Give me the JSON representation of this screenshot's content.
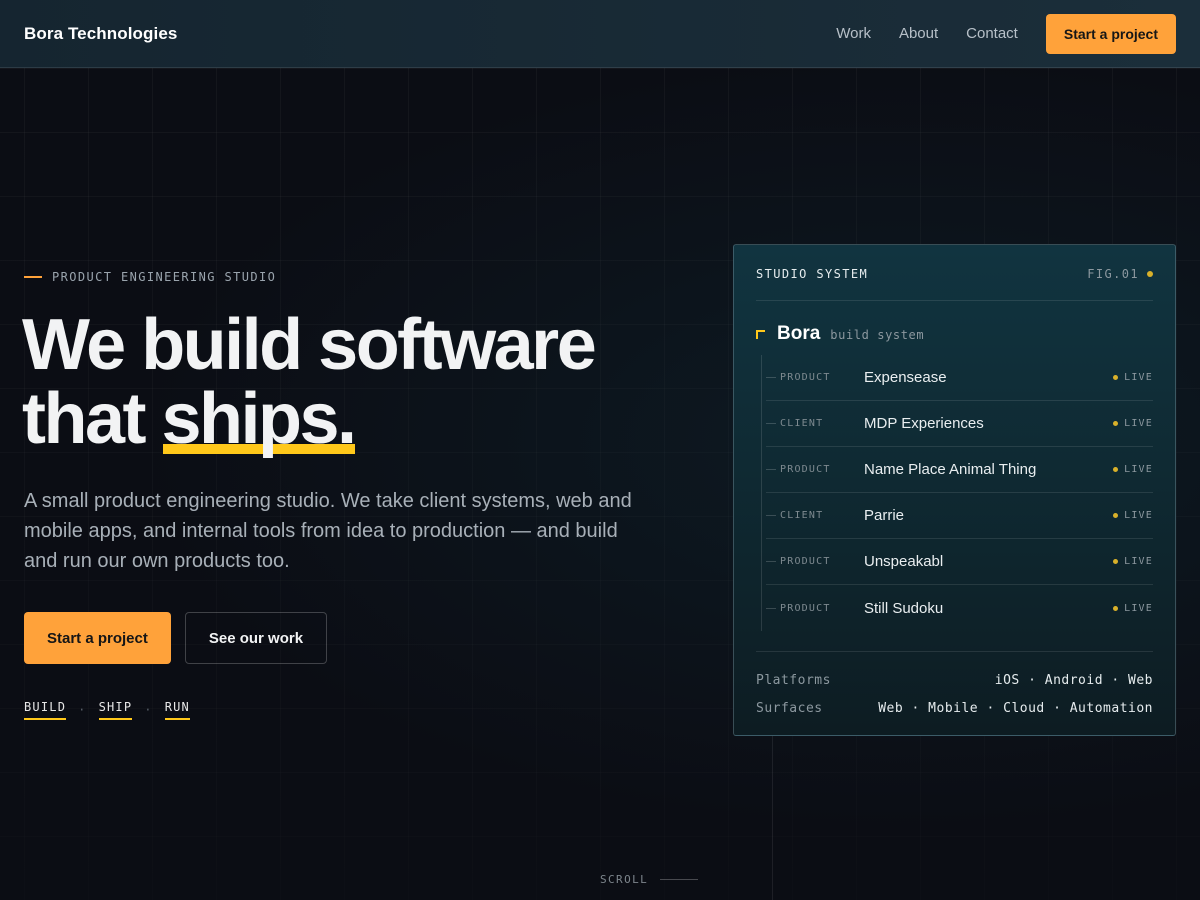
{
  "header": {
    "brand": "Bora Technologies",
    "nav": [
      "Work",
      "About",
      "Contact"
    ],
    "cta": "Start a project"
  },
  "hero": {
    "eyebrow": "PRODUCT ENGINEERING STUDIO",
    "headline_line1": "We build software",
    "headline_line2_prefix": "that ",
    "headline_highlight": "ships.",
    "lede": "A small product engineering studio. We take client systems, web and mobile apps, and internal tools from idea to production — and build and run our own products too.",
    "primary_cta": "Start a project",
    "secondary_cta": "See our work",
    "tags": [
      "BUILD",
      "SHIP",
      "RUN"
    ],
    "tag_separator": "·"
  },
  "card": {
    "title": "STUDIO SYSTEM",
    "fig": "FIG.01",
    "brand": "Bora",
    "brand_sub": "build system",
    "projects": [
      {
        "kind": "PRODUCT",
        "name": "Expensease",
        "status": "LIVE"
      },
      {
        "kind": "CLIENT",
        "name": "MDP Experiences",
        "status": "LIVE"
      },
      {
        "kind": "PRODUCT",
        "name": "Name Place Animal Thing",
        "status": "LIVE"
      },
      {
        "kind": "CLIENT",
        "name": "Parrie",
        "status": "LIVE"
      },
      {
        "kind": "PRODUCT",
        "name": "Unspeakabl",
        "status": "LIVE"
      },
      {
        "kind": "PRODUCT",
        "name": "Still Sudoku",
        "status": "LIVE"
      }
    ],
    "platforms_label": "Platforms",
    "platforms_value": "iOS · Android · Web",
    "surfaces_label": "Surfaces",
    "surfaces_value": "Web · Mobile · Cloud · Automation"
  },
  "scroll_label": "SCROLL",
  "colors": {
    "accent_orange": "#ffa23a",
    "highlight_yellow": "#ffc81a",
    "status_dot": "#d9b12a",
    "background": "#0b0d14"
  }
}
